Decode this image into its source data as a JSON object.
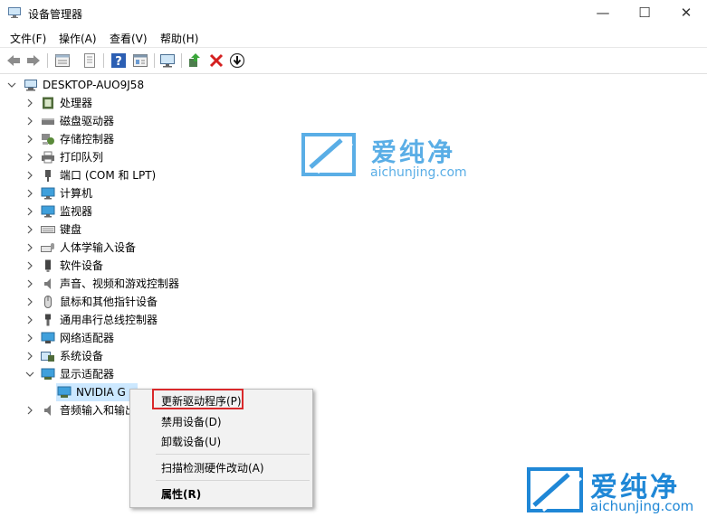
{
  "window": {
    "title": "设备管理器",
    "minimize": "—",
    "maximize": "☐",
    "close": "✕"
  },
  "menu": [
    "文件(F)",
    "操作(A)",
    "查看(V)",
    "帮助(H)"
  ],
  "toolbar": [
    "back-icon",
    "forward-icon",
    "properties-icon",
    "details-icon",
    "help-icon",
    "view-icon",
    "monitor-scan-icon",
    "update-driver-icon",
    "uninstall-icon",
    "download-icon"
  ],
  "tree": {
    "root": "DESKTOP-AUO9J58",
    "items": [
      "处理器",
      "磁盘驱动器",
      "存储控制器",
      "打印队列",
      "端口 (COM 和 LPT)",
      "计算机",
      "监视器",
      "键盘",
      "人体学输入设备",
      "软件设备",
      "声音、视频和游戏控制器",
      "鼠标和其他指针设备",
      "通用串行总线控制器",
      "网络适配器",
      "系统设备",
      "显示适配器"
    ],
    "child": "NVIDIA G",
    "after": "音频输入和输出"
  },
  "context_menu": {
    "update": "更新驱动程序(P)",
    "disable": "禁用设备(D)",
    "uninstall": "卸载设备(U)",
    "scan": "扫描检测硬件改动(A)",
    "properties": "属性(R)"
  },
  "watermark": {
    "brand": "爱纯净",
    "url": "aichunjing.com",
    "color": "#1f87d6"
  }
}
